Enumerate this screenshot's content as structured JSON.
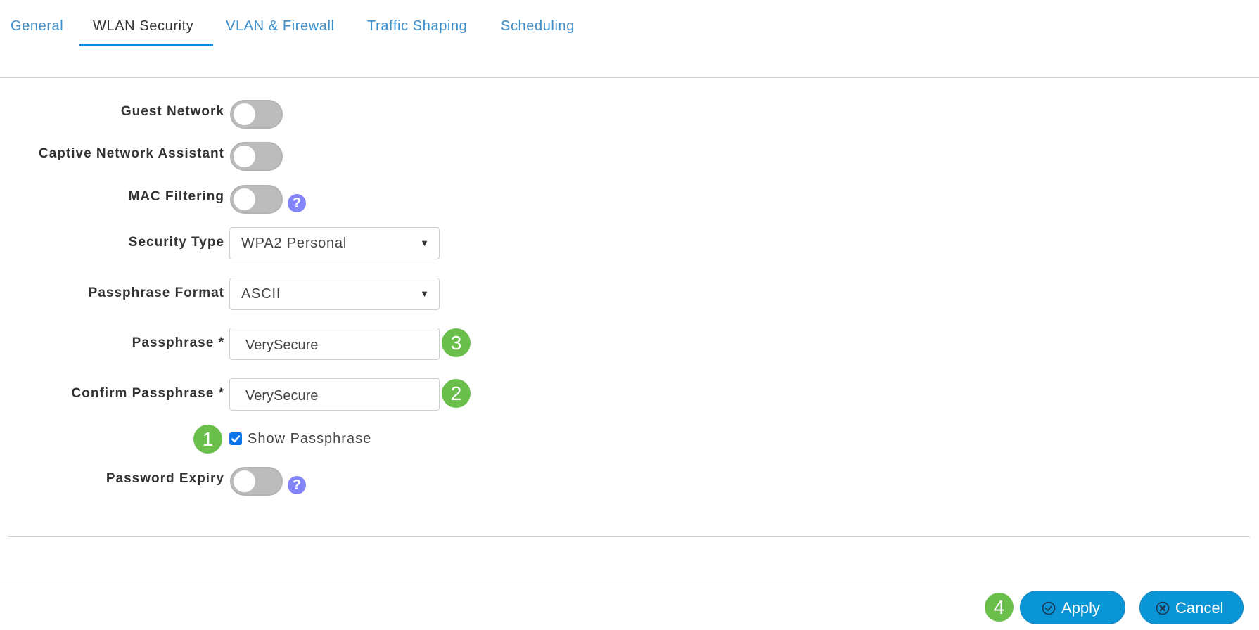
{
  "tabs": [
    {
      "label": "General",
      "active": false
    },
    {
      "label": "WLAN Security",
      "active": true
    },
    {
      "label": "VLAN & Firewall",
      "active": false
    },
    {
      "label": "Traffic Shaping",
      "active": false
    },
    {
      "label": "Scheduling",
      "active": false
    }
  ],
  "form": {
    "guest_network": {
      "label": "Guest Network",
      "enabled": false
    },
    "captive_network_assistant": {
      "label": "Captive Network Assistant",
      "enabled": false
    },
    "mac_filtering": {
      "label": "MAC Filtering",
      "enabled": false,
      "help_icon": "question-circle-icon"
    },
    "security_type": {
      "label": "Security Type",
      "value": "WPA2 Personal"
    },
    "passphrase_format": {
      "label": "Passphrase Format",
      "value": "ASCII"
    },
    "passphrase": {
      "label": "Passphrase *",
      "value": "VerySecure"
    },
    "confirm_passphrase": {
      "label": "Confirm Passphrase *",
      "value": "VerySecure"
    },
    "show_passphrase": {
      "label": "Show Passphrase",
      "checked": true
    },
    "password_expiry": {
      "label": "Password Expiry",
      "enabled": false,
      "help_icon": "question-circle-icon"
    }
  },
  "help_glyph": "?",
  "caret_glyph": "▼",
  "step_badges": {
    "show_passphrase": "1",
    "confirm_passphrase": "2",
    "passphrase": "3",
    "apply": "4"
  },
  "footer": {
    "apply_label": "Apply",
    "cancel_label": "Cancel"
  },
  "colors": {
    "accent": "#0a96d6",
    "tab_link": "#3d8fcc",
    "badge_green": "#6abf4b",
    "help_purple": "#8284f7",
    "toggle_off": "#bcbcbc",
    "checkbox_blue": "#0b74e8"
  }
}
